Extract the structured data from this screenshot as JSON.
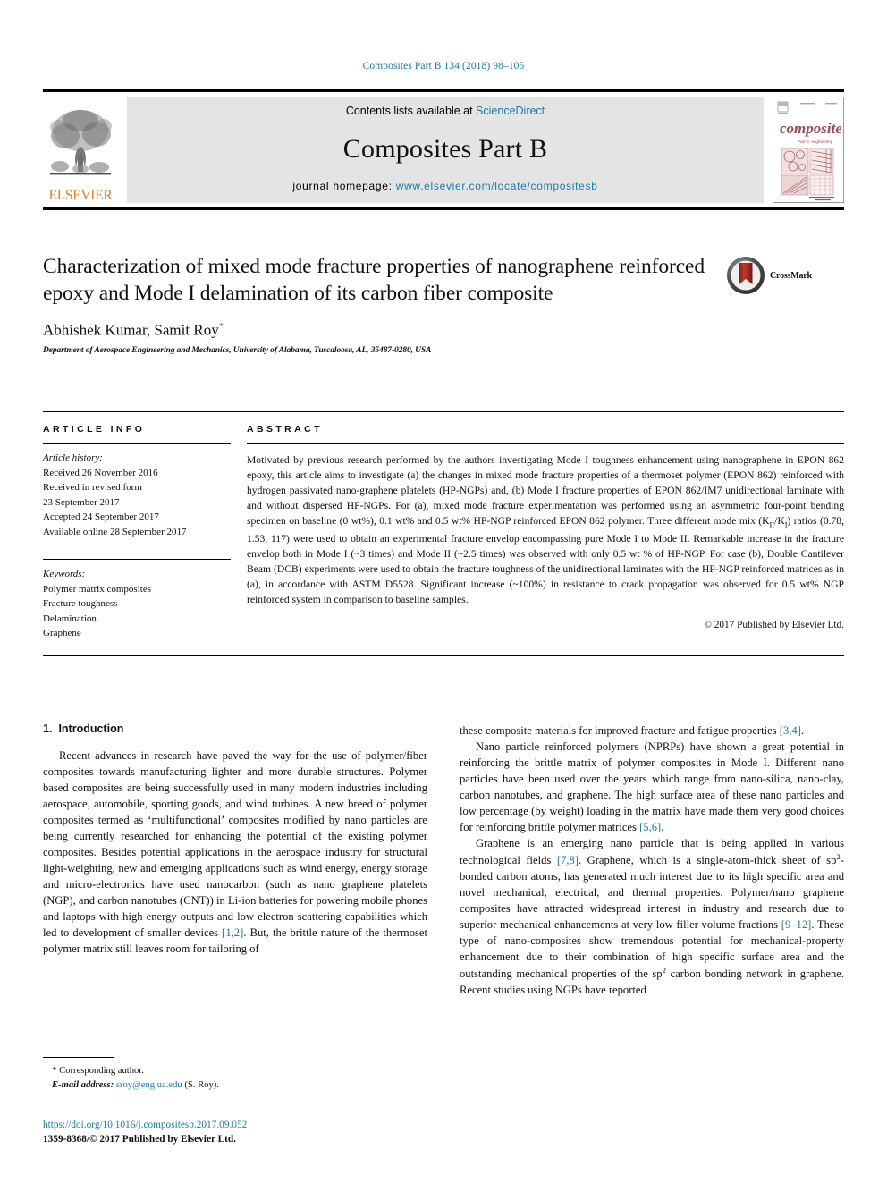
{
  "running_head": "Composites Part B 134 (2018) 98–105",
  "masthead": {
    "contents_prefix": "Contents lists available at ",
    "contents_link": "ScienceDirect",
    "journal_title": "Composites Part B",
    "homepage_prefix": "journal homepage: ",
    "homepage_url": "www.elsevier.com/locate/compositesb",
    "publisher_name": "ELSEVIER",
    "cover_title": "composites",
    "cover_subtitle": "Part B: engineering"
  },
  "title_block": {
    "title": "Characterization of mixed mode fracture properties of nanographene reinforced epoxy and Mode I delamination of its carbon fiber composite",
    "authors": "Abhishek Kumar, Samit Roy",
    "corresponding_marker": "*",
    "affiliation": "Department of Aerospace Engineering and Mechanics, University of Alabama, Tuscaloosa, AL, 35487-0280, USA",
    "crossmark_label": "CrossMark"
  },
  "article_info": {
    "heading": "ARTICLE INFO",
    "history_label": "Article history:",
    "history_lines": [
      "Received 26 November 2016",
      "Received in revised form",
      "23 September 2017",
      "Accepted 24 September 2017",
      "Available online 28 September 2017"
    ],
    "keywords_label": "Keywords:",
    "keywords": [
      "Polymer matrix composites",
      "Fracture toughness",
      "Delamination",
      "Graphene"
    ]
  },
  "abstract": {
    "heading": "ABSTRACT",
    "text": "Motivated by previous research performed by the authors investigating Mode I toughness enhancement using nanographene in EPON 862 epoxy, this article aims to investigate (a) the changes in mixed mode fracture properties of a thermoset polymer (EPON 862) reinforced with hydrogen passivated nano-graphene platelets (HP-NGPs) and, (b) Mode I fracture properties of EPON 862/IM7 unidirectional laminate with and without dispersed HP-NGPs. For (a), mixed mode fracture experimentation was performed using an asymmetric four-point bending specimen on baseline (0 wt%), 0.1 wt% and 0.5 wt% HP-NGP reinforced EPON 862 polymer. Three different mode mix (KII/KI) ratios (0.78, 1.53, 117) were used to obtain an experimental fracture envelop encompassing pure Mode I to Mode II. Remarkable increase in the fracture envelop both in Mode I (~3 times) and Mode II (~2.5 times) was observed with only 0.5 wt % of HP-NGP. For case (b), Double Cantilever Beam (DCB) experiments were used to obtain the fracture toughness of the unidirectional laminates with the HP-NGP reinforced matrices as in (a), in accordance with ASTM D5528. Significant increase (~100%) in resistance to crack propagation was observed for 0.5 wt% NGP reinforced system in comparison to baseline samples.",
    "copyright": "© 2017 Published by Elsevier Ltd."
  },
  "introduction": {
    "number": "1.",
    "heading": "Introduction",
    "left_paragraphs": [
      "Recent advances in research have paved the way for the use of polymer/fiber composites towards manufacturing lighter and more durable structures. Polymer based composites are being successfully used in many modern industries including aerospace, automobile, sporting goods, and wind turbines. A new breed of polymer composites termed as ‘multifunctional’ composites modified by nano particles are being currently researched for enhancing the potential of the existing polymer composites. Besides potential applications in the aerospace industry for structural light-weighting, new and emerging applications such as wind energy, energy storage and micro-electronics have used nanocarbon (such as nano graphene platelets (NGP), and carbon nanotubes (CNT)) in Li-ion batteries for powering mobile phones and laptops with high energy outputs and low electron scattering capabilities which led to development of smaller devices [1,2]. But, the brittle nature of the thermoset polymer matrix still leaves room for tailoring of"
    ],
    "right_paragraphs": [
      "these composite materials for improved fracture and fatigue properties [3,4].",
      "Nano particle reinforced polymers (NPRPs) have shown a great potential in reinforcing the brittle matrix of polymer composites in Mode I. Different nano particles have been used over the years which range from nano-silica, nano-clay, carbon nanotubes, and graphene. The high surface area of these nano particles and low percentage (by weight) loading in the matrix have made them very good choices for reinforcing brittle polymer matrices [5,6].",
      "Graphene is an emerging nano particle that is being applied in various technological fields [7,8]. Graphene, which is a single-atom-thick sheet of sp2-bonded carbon atoms, has generated much interest due to its high specific area and novel mechanical, electrical, and thermal properties. Polymer/nano graphene composites have attracted widespread interest in industry and research due to superior mechanical enhancements at very low filler volume fractions [9–12]. These type of nano-composites show tremendous potential for mechanical-property enhancement due to their combination of high specific surface area and the outstanding mechanical properties of the sp2 carbon bonding network in graphene. Recent studies using NGPs have reported"
    ],
    "citations": [
      "[1,2]",
      "[3,4]",
      "[5,6]",
      "[7,8]",
      "[9–12]"
    ]
  },
  "footnote": {
    "star": "*",
    "corresponding": "Corresponding author.",
    "email_label": "E-mail address:",
    "email": "sroy@eng.ua.edu",
    "email_owner": "(S. Roy)."
  },
  "footer": {
    "doi": "https://doi.org/10.1016/j.compositesb.2017.09.052",
    "issn_line": "1359-8368/© 2017 Published by Elsevier Ltd."
  },
  "colors": {
    "link": "#1a7aa8",
    "elsevier_orange": "#E87D1E",
    "band_gray": "#e4e4e4",
    "cover_maroon": "#9d4b52"
  }
}
